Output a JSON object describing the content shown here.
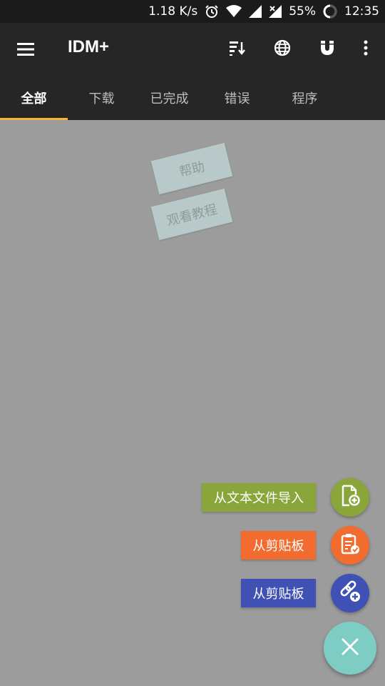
{
  "status_bar": {
    "speed": "1.18 K/s",
    "battery": "55%",
    "time": "12:35"
  },
  "app_bar": {
    "title": "IDM+"
  },
  "tabs": [
    {
      "label": "全部",
      "active": true
    },
    {
      "label": "下载",
      "active": false
    },
    {
      "label": "已完成",
      "active": false
    },
    {
      "label": "错误",
      "active": false
    },
    {
      "label": "程序",
      "active": false
    }
  ],
  "stickers": {
    "help": "帮助",
    "tutorial": "观看教程"
  },
  "fab_menu": {
    "import_text_file": "从文本文件导入",
    "from_clipboard_1": "从剪贴板",
    "from_clipboard_2": "从剪贴板"
  },
  "colors": {
    "background": "#9c9c9c",
    "app_bar": "#262626",
    "tab_indicator": "#f2b632",
    "import_green": "#8aa63a",
    "clipboard_orange": "#f26c2f",
    "link_blue": "#3f51b5",
    "main_fab_teal": "#7ecdc4"
  },
  "icons": {
    "menu": "hamburger-icon",
    "sort": "sort-icon",
    "browser": "globe-icon",
    "magnet": "magnet-icon",
    "more": "more-vertical-icon",
    "import": "file-import-icon",
    "clipboard": "clipboard-check-icon",
    "link": "link-add-icon",
    "close": "close-icon"
  }
}
